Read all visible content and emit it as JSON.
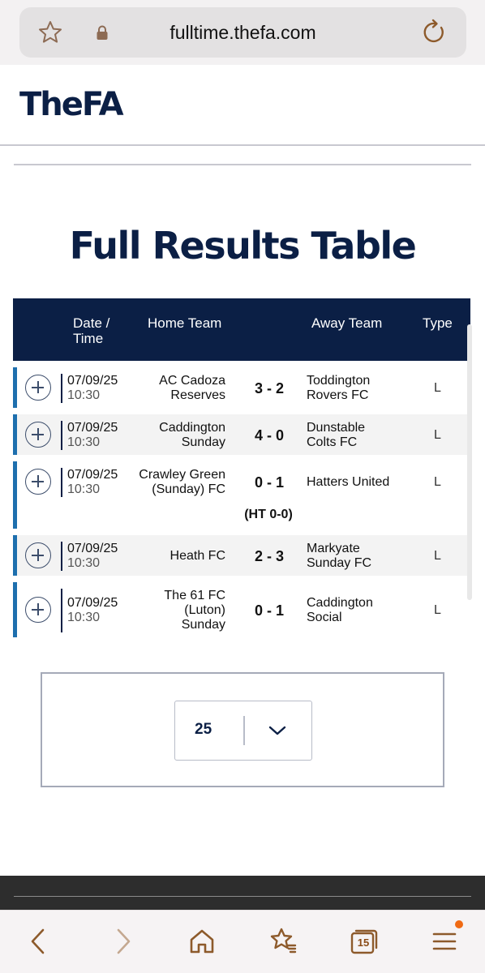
{
  "browser": {
    "url": "fulltime.thefa.com",
    "tab_count": "15"
  },
  "header": {
    "logo_text": "TheFA"
  },
  "page_title": "Full Results Table",
  "table": {
    "headers": {
      "date_time_line1": "Date /",
      "date_time_line2": "Time",
      "home": "Home Team",
      "away": "Away Team",
      "type": "Type"
    },
    "rows": [
      {
        "date": "07/09/25",
        "time": "10:30",
        "home_lines": [
          "AC Cadoza",
          "Reserves"
        ],
        "score": "3 - 2",
        "away_lines": [
          "Toddington",
          "Rovers FC"
        ],
        "type": "L",
        "ht": ""
      },
      {
        "date": "07/09/25",
        "time": "10:30",
        "home_lines": [
          "Caddington",
          "Sunday"
        ],
        "score": "4 - 0",
        "away_lines": [
          "Dunstable",
          "Colts FC"
        ],
        "type": "L",
        "ht": ""
      },
      {
        "date": "07/09/25",
        "time": "10:30",
        "home_lines": [
          "Crawley Green",
          "(Sunday) FC"
        ],
        "score": "0 - 1",
        "away_lines": [
          "Hatters United"
        ],
        "type": "L",
        "ht": "(HT 0-0)"
      },
      {
        "date": "07/09/25",
        "time": "10:30",
        "home_lines": [
          "Heath FC"
        ],
        "score": "2 - 3",
        "away_lines": [
          "Markyate",
          "Sunday FC"
        ],
        "type": "L",
        "ht": ""
      },
      {
        "date": "07/09/25",
        "time": "10:30",
        "home_lines": [
          "The 61 FC",
          "(Luton)",
          "Sunday"
        ],
        "score": "0 - 1",
        "away_lines": [
          "Caddington",
          "Social"
        ],
        "type": "L",
        "ht": ""
      }
    ]
  },
  "pagination": {
    "per_page_value": "25"
  },
  "colors": {
    "brand_navy": "#0b1f45",
    "row_accent": "#1d6fae",
    "notification": "#f06a13"
  }
}
